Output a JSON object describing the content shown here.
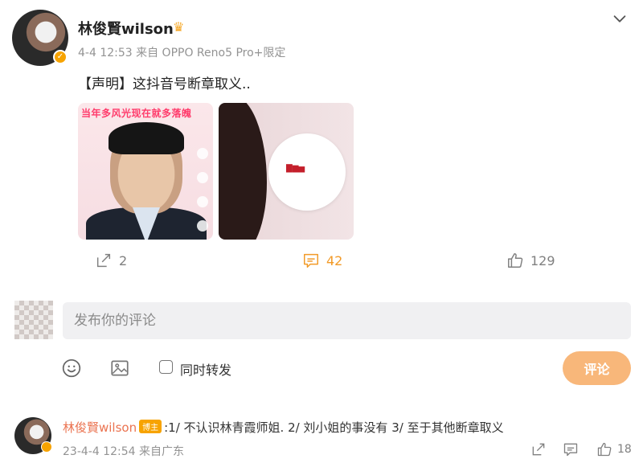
{
  "post": {
    "author": "林俊賢wilson",
    "meta": "4-4 12:53  来自 OPPO Reno5 Pro+限定",
    "text": "【声明】这抖音号断章取义..",
    "image1_banner": "当年多风光现在就多落魄"
  },
  "actions": {
    "repost_count": "2",
    "comment_count": "42",
    "like_count": "129"
  },
  "comment_box": {
    "placeholder": "发布你的评论",
    "also_repost_label": "同时转发",
    "submit_label": "评论"
  },
  "reply": {
    "author": "林俊賢wilson",
    "tag": "博主",
    "text": ":1/ 不认识林青霞师姐. 2/ 刘小姐的事没有 3/ 至于其他断章取义",
    "meta": "23-4-4 12:54  来自广东",
    "like_count": "18"
  },
  "colors": {
    "accent_orange": "#f29a27",
    "submit_button": "#f8b77a",
    "reply_name": "#eb7350",
    "badge": "#f7a300"
  }
}
